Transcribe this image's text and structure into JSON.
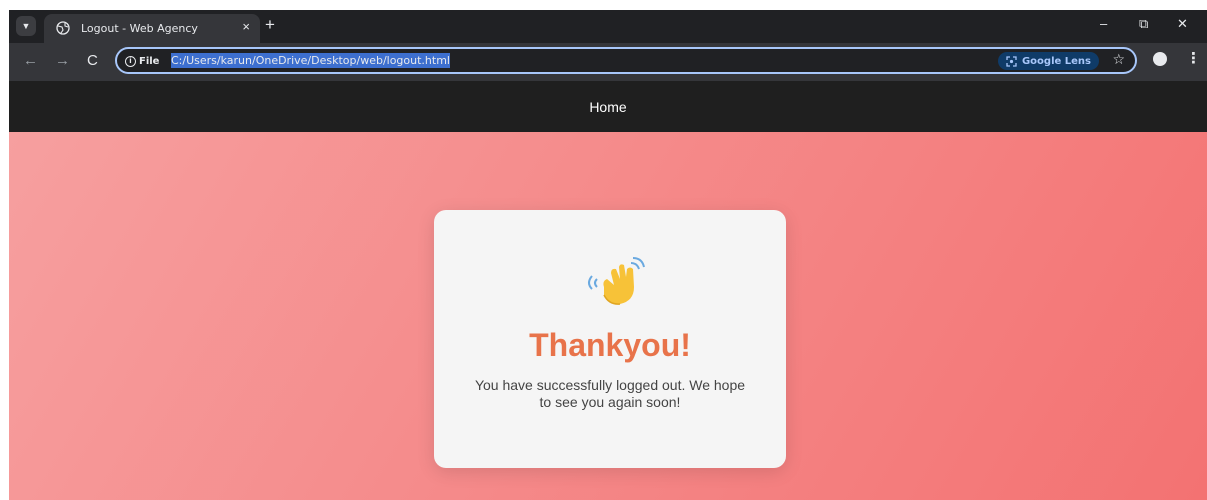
{
  "browser": {
    "tab_title": "Logout - Web Agency",
    "tab_close": "×",
    "new_tab": "+",
    "minimize": "–",
    "restore": "⧉",
    "close": "✕",
    "back": "←",
    "forward": "→",
    "reload": "C",
    "info_chip_label": "File",
    "url": "C:/Users/karun/OneDrive/Desktop/web/logout.html",
    "lens_label": "Google Lens",
    "star": "☆",
    "menu": "⋮"
  },
  "navbar": {
    "home_label": "Home"
  },
  "card": {
    "icon": "waving-hand-icon",
    "title": "Thankyou!",
    "message": "You have successfully logged out. We hope to see you again soon!"
  },
  "colors": {
    "accent_title": "#e8734a",
    "page_gradient_start": "#f6a0a0",
    "page_gradient_end": "#f37272",
    "navbar_bg": "#1f1f1f"
  }
}
